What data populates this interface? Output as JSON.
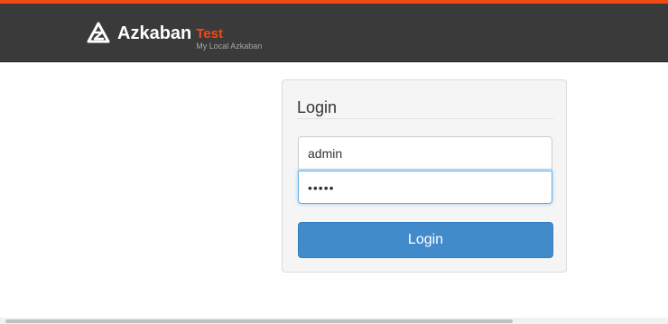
{
  "header": {
    "brand_name": "Azkaban",
    "environment": "Test",
    "tagline": "My Local Azkaban",
    "logo_icon": "azkaban-logo-icon",
    "accent_color": "#f04a14"
  },
  "login": {
    "title": "Login",
    "username_value": "admin",
    "password_value": "•••••",
    "button_label": "Login",
    "button_color": "#428bca"
  }
}
